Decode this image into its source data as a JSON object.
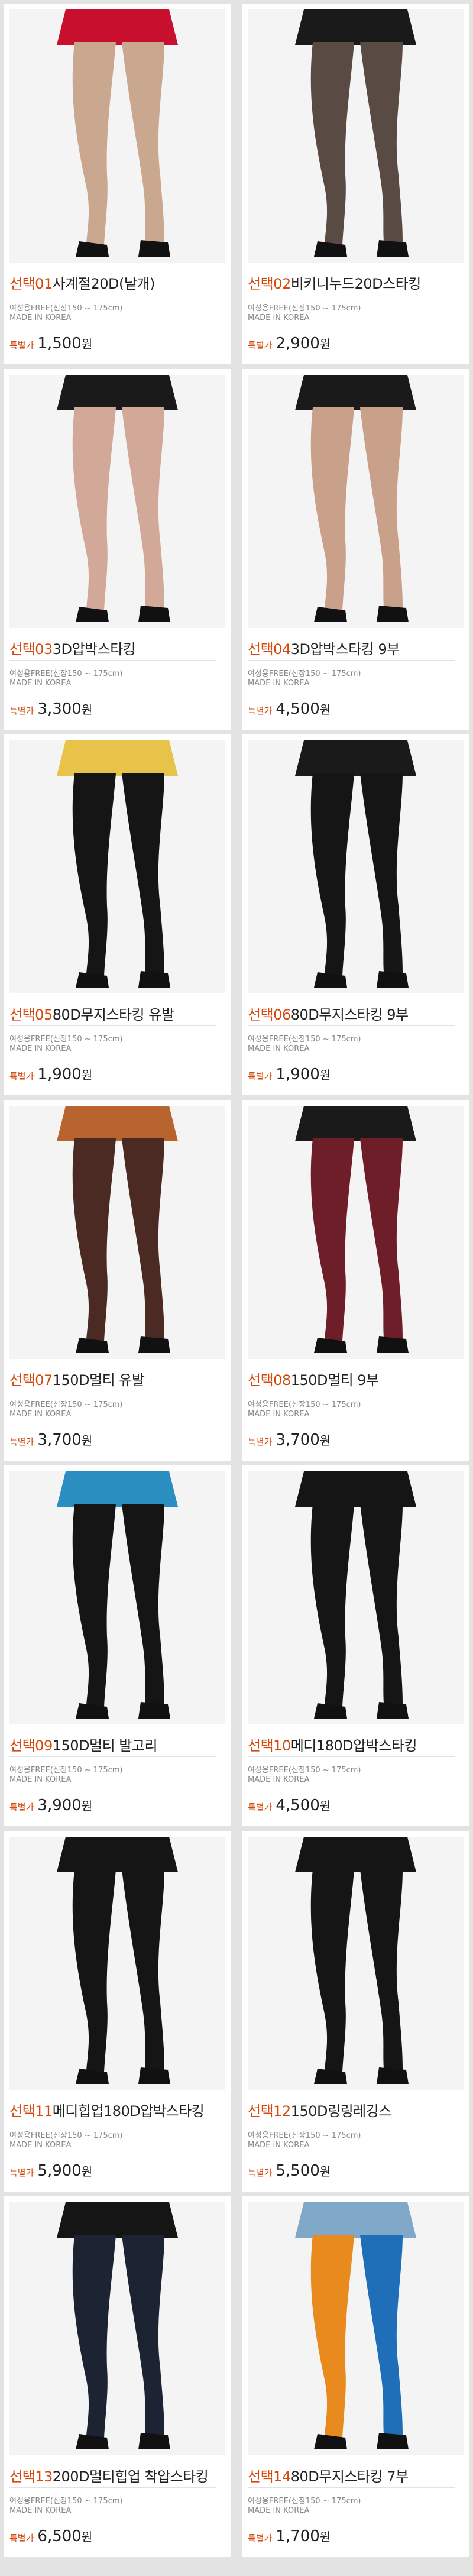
{
  "products": [
    {
      "prefix": "선택",
      "num": "01",
      "name": "사계절20D(낱개)",
      "size": "여성용FREE(신장150 ~ 175cm)",
      "origin": "MADE IN KOREA",
      "price_label": "특별가",
      "price": "1,500",
      "won": "원",
      "tone": "#c9a88f",
      "outfit": "#c8102e"
    },
    {
      "prefix": "선택",
      "num": "02",
      "name": "비키니누드20D스타킹",
      "size": "여성용FREE(신장150 ~ 175cm)",
      "origin": "MADE IN KOREA",
      "price_label": "특별가",
      "price": "2,900",
      "won": "원",
      "tone": "#5a4a44",
      "outfit": "#1a1a1a"
    },
    {
      "prefix": "선택",
      "num": "03",
      "name": "3D압박스타킹",
      "size": "여성용FREE(신장150 ~ 175cm)",
      "origin": "MADE IN KOREA",
      "price_label": "특별가",
      "price": "3,300",
      "won": "원",
      "tone": "#d2a898",
      "outfit": "#1a1a1a"
    },
    {
      "prefix": "선택",
      "num": "04",
      "name": "3D압박스타킹 9부",
      "size": "여성용FREE(신장150 ~ 175cm)",
      "origin": "MADE IN KOREA",
      "price_label": "특별가",
      "price": "4,500",
      "won": "원",
      "tone": "#c9a08a",
      "outfit": "#1a1a1a"
    },
    {
      "prefix": "선택",
      "num": "05",
      "name": "80D무지스타킹 유발",
      "size": "여성용FREE(신장150 ~ 175cm)",
      "origin": "MADE IN KOREA",
      "price_label": "특별가",
      "price": "1,900",
      "won": "원",
      "tone": "#151515",
      "outfit": "#e8c34a"
    },
    {
      "prefix": "선택",
      "num": "06",
      "name": "80D무지스타킹 9부",
      "size": "여성용FREE(신장150 ~ 175cm)",
      "origin": "MADE IN KOREA",
      "price_label": "특별가",
      "price": "1,900",
      "won": "원",
      "tone": "#151515",
      "outfit": "#1a1a1a"
    },
    {
      "prefix": "선택",
      "num": "07",
      "name": "150D멀티 유발",
      "size": "여성용FREE(신장150 ~ 175cm)",
      "origin": "MADE IN KOREA",
      "price_label": "특별가",
      "price": "3,700",
      "won": "원",
      "tone": "#4a2a22",
      "outfit": "#b8642e"
    },
    {
      "prefix": "선택",
      "num": "08",
      "name": "150D멀티 9부",
      "size": "여성용FREE(신장150 ~ 175cm)",
      "origin": "MADE IN KOREA",
      "price_label": "특별가",
      "price": "3,700",
      "won": "원",
      "tone": "#6e1e28",
      "outfit": "#1a1a1a"
    },
    {
      "prefix": "선택",
      "num": "09",
      "name": "150D멀티 발고리",
      "size": "여성용FREE(신장150 ~ 175cm)",
      "origin": "MADE IN KOREA",
      "price_label": "특별가",
      "price": "3,900",
      "won": "원",
      "tone": "#151515",
      "outfit": "#2a8fc0"
    },
    {
      "prefix": "선택",
      "num": "10",
      "name": "메디180D압박스타킹",
      "size": "여성용FREE(신장150 ~ 175cm)",
      "origin": "MADE IN KOREA",
      "price_label": "특별가",
      "price": "4,500",
      "won": "원",
      "tone": "#151515",
      "outfit": "#151515"
    },
    {
      "prefix": "선택",
      "num": "11",
      "name": "메디힙업180D압박스타킹",
      "size": "여성용FREE(신장150 ~ 175cm)",
      "origin": "MADE IN KOREA",
      "price_label": "특별가",
      "price": "5,900",
      "won": "원",
      "tone": "#151515",
      "outfit": "#151515"
    },
    {
      "prefix": "선택",
      "num": "12",
      "name": "150D링링레깅스",
      "size": "여성용FREE(신장150 ~ 175cm)",
      "origin": "MADE IN KOREA",
      "price_label": "특별가",
      "price": "5,500",
      "won": "원",
      "tone": "#151515",
      "outfit": "#151515"
    },
    {
      "prefix": "선택",
      "num": "13",
      "name": "200D멀티힙업 착압스타킹",
      "size": "여성용FREE(신장150 ~ 175cm)",
      "origin": "MADE IN KOREA",
      "price_label": "특별가",
      "price": "6,500",
      "won": "원",
      "tone": "#1c2333",
      "outfit": "#151515"
    },
    {
      "prefix": "선택",
      "num": "14",
      "name": "80D무지스타킹 7부",
      "size": "여성용FREE(신장150 ~ 175cm)",
      "origin": "MADE IN KOREA",
      "price_label": "특별가",
      "price": "1,700",
      "won": "원",
      "tone": "#e98a1e",
      "outfit": "#7fa8c9"
    }
  ],
  "second_tone": {
    "13": "#1e6fb8"
  }
}
